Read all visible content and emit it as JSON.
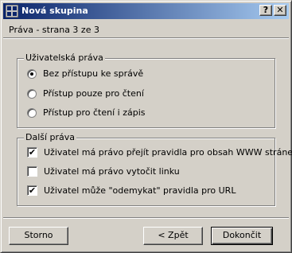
{
  "window": {
    "title": "Nová skupina",
    "help_label": "?",
    "close_label": "✕"
  },
  "page": {
    "label": "Práva - strana 3 ze 3"
  },
  "user_rights": {
    "title": "Uživatelská práva",
    "selected_index": 0,
    "options": [
      {
        "label": "Bez přístupu ke správě",
        "selected": true
      },
      {
        "label": "Přístup pouze pro čtení",
        "selected": false
      },
      {
        "label": "Přístup pro čtení i zápis",
        "selected": false
      }
    ]
  },
  "other_rights": {
    "title": "Další práva",
    "items": [
      {
        "label": "Uživatel má právo přejít pravidla pro obsah WWW stránek",
        "checked": true
      },
      {
        "label": "Uživatel má právo vytočit linku",
        "checked": false
      },
      {
        "label": "Uživatel může \"odemykat\" pravidla pro URL",
        "checked": true
      }
    ]
  },
  "buttons": {
    "cancel": "Storno",
    "back": "< Zpět",
    "finish": "Dokončit"
  },
  "check_mark": "✔"
}
